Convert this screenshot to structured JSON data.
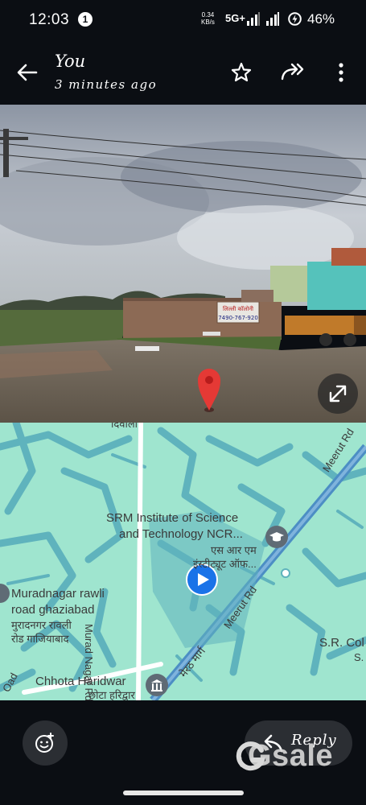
{
  "status": {
    "time": "12:03",
    "notification_count": "1",
    "net_speed_value": "0.34",
    "net_speed_unit": "KB/s",
    "network": "5G+",
    "battery": "46%"
  },
  "header": {
    "sender": "You",
    "subtitle": "3 minutes ago",
    "icons": [
      "back-arrow-icon",
      "star-icon",
      "forward-icon",
      "more-vert-icon"
    ]
  },
  "photo": {
    "sign_line1": "लिल्ली कॉलोनी",
    "sign_line2": "7490-767-920"
  },
  "map": {
    "labels": {
      "top_hindi": "दिवाला",
      "srm_line1": "SRM Institute of Science",
      "srm_line2": "and Technology NCR...",
      "srm_hindi_line1": "एस आर एम",
      "srm_hindi_line2": "इंस्टीट्यूट ऑफ...",
      "muradnagar_line1": "Muradnagar rawli",
      "muradnagar_line2": "road ghaziabad",
      "muradnagar_hindi_line1": "मुरादनगर रावली",
      "muradnagar_hindi_line2": "रोड गाजियाबाद",
      "murad_nagar_rd": "Murad Nagar Rd",
      "meerut_rd_upper": "Meerut Rd",
      "meerut_rd_mid": "Meerut Rd",
      "meerut_hindi": "मेरठ मार्ग",
      "sr_col": "S.R. Col",
      "sr_col_sub": "S.",
      "chhota_haridwar": "Chhota Haridwar",
      "chhota_haridwar_hindi": "छोटा हरिद्वार",
      "oad": "Oad"
    }
  },
  "footer": {
    "reply_label": "Reply",
    "watermark": "Gsale"
  },
  "colors": {
    "background": "#0b0e13",
    "map_land": "#9fe5cf",
    "map_roads": "#5fb3bd",
    "pin_red": "#e53935",
    "location_blue": "#1a73e8"
  }
}
